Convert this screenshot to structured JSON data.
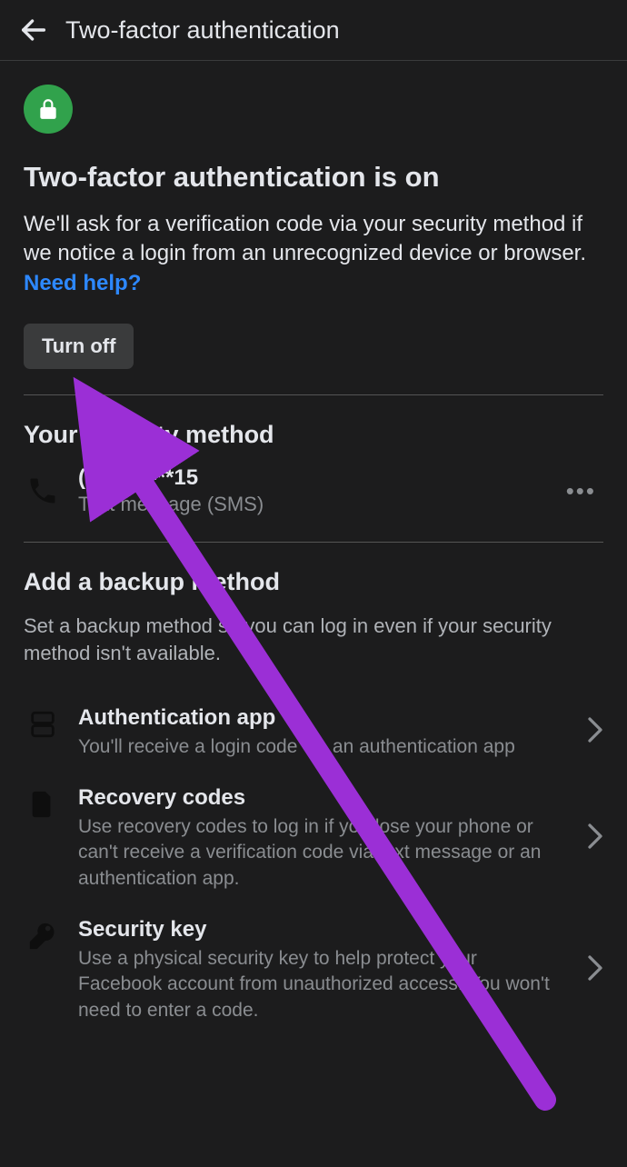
{
  "header": {
    "title": "Two-factor authentication"
  },
  "status": {
    "heading": "Two-factor authentication is on",
    "description": "We'll ask for a verification code via your security method if we notice a login from an unrecognized device or browser. ",
    "help_link": "Need help?",
    "turn_off_label": "Turn off"
  },
  "method_section": {
    "heading": "Your security method",
    "phone": "(***) ***-**15",
    "type": "Text message (SMS)"
  },
  "backup_section": {
    "heading": "Add a backup method",
    "description": "Set a backup method so you can log in even if your security method isn't available."
  },
  "options": [
    {
      "title": "Authentication app",
      "desc": "You'll receive a login code via an authentication app"
    },
    {
      "title": "Recovery codes",
      "desc": "Use recovery codes to log in if you lose your phone or can't receive a verification code via text message or an authentication app."
    },
    {
      "title": "Security key",
      "desc": "Use a physical security key to help protect your Facebook account from unauthorized access. You won't need to enter a code."
    }
  ],
  "annotation": {
    "arrow_color": "#9b2fd6"
  }
}
